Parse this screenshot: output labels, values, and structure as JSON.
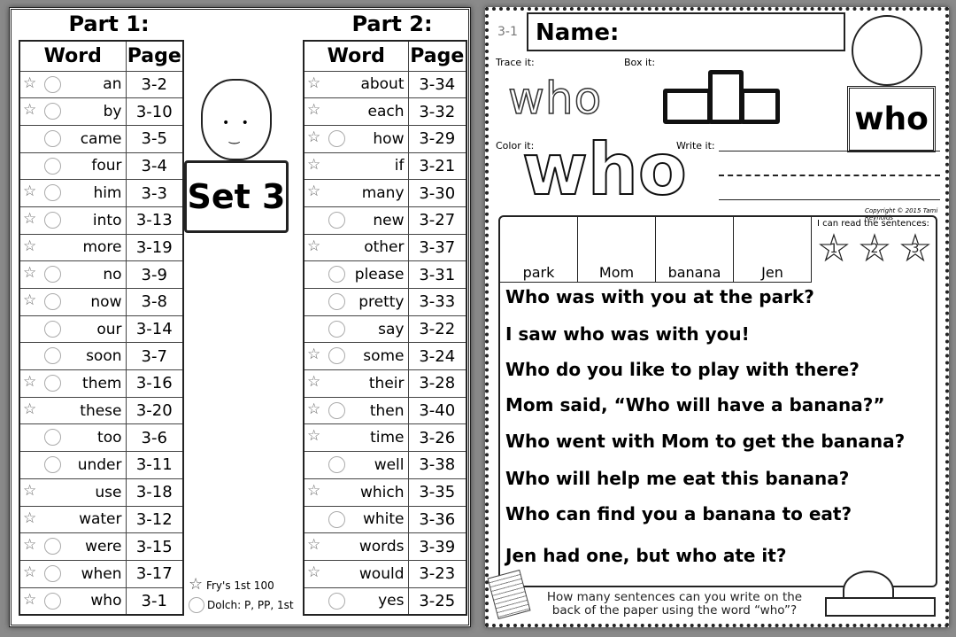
{
  "left": {
    "part1": {
      "title": "Part 1:",
      "col_word": "Word",
      "col_page": "Page",
      "rows": [
        {
          "word": "an",
          "page": "3-2",
          "star": true,
          "circle": true
        },
        {
          "word": "by",
          "page": "3-10",
          "star": true,
          "circle": true
        },
        {
          "word": "came",
          "page": "3-5",
          "star": false,
          "circle": true
        },
        {
          "word": "four",
          "page": "3-4",
          "star": false,
          "circle": true
        },
        {
          "word": "him",
          "page": "3-3",
          "star": true,
          "circle": true
        },
        {
          "word": "into",
          "page": "3-13",
          "star": true,
          "circle": true
        },
        {
          "word": "more",
          "page": "3-19",
          "star": true,
          "circle": false
        },
        {
          "word": "no",
          "page": "3-9",
          "star": true,
          "circle": true
        },
        {
          "word": "now",
          "page": "3-8",
          "star": true,
          "circle": true
        },
        {
          "word": "our",
          "page": "3-14",
          "star": false,
          "circle": true
        },
        {
          "word": "soon",
          "page": "3-7",
          "star": false,
          "circle": true
        },
        {
          "word": "them",
          "page": "3-16",
          "star": true,
          "circle": true
        },
        {
          "word": "these",
          "page": "3-20",
          "star": true,
          "circle": false
        },
        {
          "word": "too",
          "page": "3-6",
          "star": false,
          "circle": true
        },
        {
          "word": "under",
          "page": "3-11",
          "star": false,
          "circle": true
        },
        {
          "word": "use",
          "page": "3-18",
          "star": true,
          "circle": false
        },
        {
          "word": "water",
          "page": "3-12",
          "star": true,
          "circle": false
        },
        {
          "word": "were",
          "page": "3-15",
          "star": true,
          "circle": true
        },
        {
          "word": "when",
          "page": "3-17",
          "star": true,
          "circle": true
        },
        {
          "word": "who",
          "page": "3-1",
          "star": true,
          "circle": true
        }
      ]
    },
    "part2": {
      "title": "Part 2:",
      "col_word": "Word",
      "col_page": "Page",
      "rows": [
        {
          "word": "about",
          "page": "3-34",
          "star": true,
          "circle": false
        },
        {
          "word": "each",
          "page": "3-32",
          "star": true,
          "circle": false
        },
        {
          "word": "how",
          "page": "3-29",
          "star": true,
          "circle": true
        },
        {
          "word": "if",
          "page": "3-21",
          "star": true,
          "circle": false
        },
        {
          "word": "many",
          "page": "3-30",
          "star": true,
          "circle": false
        },
        {
          "word": "new",
          "page": "3-27",
          "star": false,
          "circle": true
        },
        {
          "word": "other",
          "page": "3-37",
          "star": true,
          "circle": false
        },
        {
          "word": "please",
          "page": "3-31",
          "star": false,
          "circle": true
        },
        {
          "word": "pretty",
          "page": "3-33",
          "star": false,
          "circle": true
        },
        {
          "word": "say",
          "page": "3-22",
          "star": false,
          "circle": true
        },
        {
          "word": "some",
          "page": "3-24",
          "star": true,
          "circle": true
        },
        {
          "word": "their",
          "page": "3-28",
          "star": true,
          "circle": false
        },
        {
          "word": "then",
          "page": "3-40",
          "star": true,
          "circle": true
        },
        {
          "word": "time",
          "page": "3-26",
          "star": true,
          "circle": false
        },
        {
          "word": "well",
          "page": "3-38",
          "star": false,
          "circle": true
        },
        {
          "word": "which",
          "page": "3-35",
          "star": true,
          "circle": false
        },
        {
          "word": "white",
          "page": "3-36",
          "star": false,
          "circle": true
        },
        {
          "word": "words",
          "page": "3-39",
          "star": true,
          "circle": false
        },
        {
          "word": "would",
          "page": "3-23",
          "star": true,
          "circle": false
        },
        {
          "word": "yes",
          "page": "3-25",
          "star": false,
          "circle": true
        }
      ]
    },
    "sign": "Set 3",
    "legend": {
      "star": "Fry's 1st 100",
      "circle": "Dolch: P, PP, 1st"
    }
  },
  "right": {
    "page_number": "3-1",
    "name_label": "Name:",
    "trace_label": "Trace it:",
    "box_label": "Box it:",
    "color_label": "Color it:",
    "write_label": "Write it:",
    "word": "who",
    "copyright": "Copyright © 2015 Tami Reynolds",
    "pictures": [
      "park",
      "Mom",
      "banana",
      "Jen"
    ],
    "read_label": "I can read the sentences:",
    "read_stars": [
      "1",
      "2",
      "3"
    ],
    "sentences": [
      "Who was with you at the park?",
      "I saw who was with you!",
      "Who do you like to play with there?",
      "Mom said, “Who will have a banana?”",
      "Who went with Mom to get the banana?",
      "Who will help me eat this banana?",
      "Who can find you a banana to eat?",
      "Jen had one, but who ate it?"
    ],
    "prompt_line1": "How many sentences can you write on the",
    "prompt_line2": "back of the paper using the word “who”?"
  }
}
